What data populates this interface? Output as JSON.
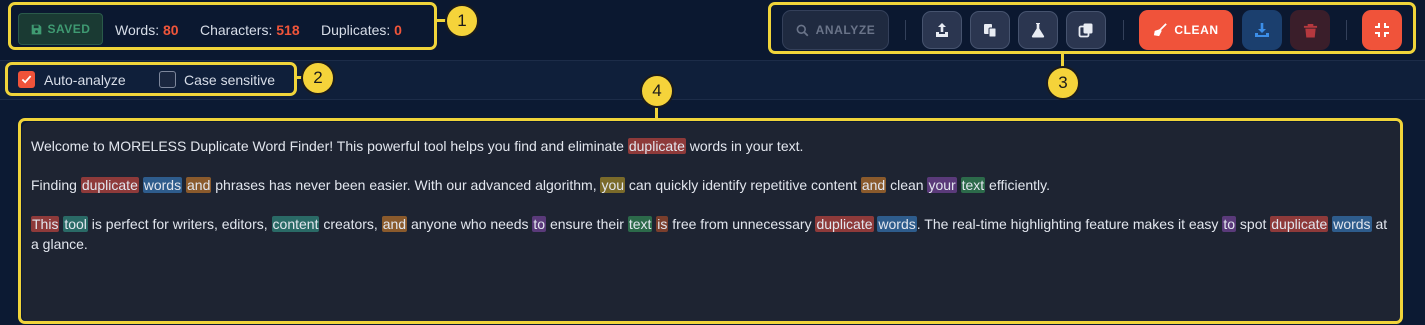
{
  "toolbar": {
    "saved_label": "SAVED",
    "words_label": "Words:",
    "words_value": "80",
    "chars_label": "Characters:",
    "chars_value": "518",
    "dups_label": "Duplicates:",
    "dups_value": "0",
    "analyze_label": "ANALYZE",
    "clean_label": "CLEAN",
    "icons": [
      "upload-icon",
      "paste-icon",
      "flask-icon",
      "copy-icon",
      "broom-icon",
      "download-icon",
      "trash-icon",
      "collapse-icon"
    ]
  },
  "options": {
    "auto_analyze": {
      "label": "Auto-analyze",
      "checked": true
    },
    "case_sensitive": {
      "label": "Case sensitive",
      "checked": false
    }
  },
  "callouts": [
    "1",
    "2",
    "3",
    "4"
  ],
  "editor": {
    "paragraphs": [
      [
        {
          "t": "Welcome to MORELESS Duplicate Word Finder! This powerful tool helps you find and eliminate "
        },
        {
          "t": "duplicate",
          "c": "red"
        },
        {
          "t": " words in your text."
        }
      ],
      [
        {
          "t": "Finding "
        },
        {
          "t": "duplicate",
          "c": "red"
        },
        {
          "t": " "
        },
        {
          "t": "words",
          "c": "blue"
        },
        {
          "t": " "
        },
        {
          "t": "and",
          "c": "orange"
        },
        {
          "t": " phrases has never been easier. With our advanced algorithm, "
        },
        {
          "t": "you",
          "c": "olive"
        },
        {
          "t": " can quickly identify repetitive content "
        },
        {
          "t": "and",
          "c": "orange"
        },
        {
          "t": " clean "
        },
        {
          "t": "your",
          "c": "purple"
        },
        {
          "t": " "
        },
        {
          "t": "text",
          "c": "green"
        },
        {
          "t": " efficiently."
        }
      ],
      [
        {
          "t": "This",
          "c": "red"
        },
        {
          "t": " "
        },
        {
          "t": "tool",
          "c": "teal"
        },
        {
          "t": " is perfect for writers, editors, "
        },
        {
          "t": "content",
          "c": "teal"
        },
        {
          "t": " creators, "
        },
        {
          "t": "and",
          "c": "orange"
        },
        {
          "t": " anyone who needs "
        },
        {
          "t": "to",
          "c": "purple"
        },
        {
          "t": " ensure their "
        },
        {
          "t": "text",
          "c": "green"
        },
        {
          "t": " "
        },
        {
          "t": "is",
          "c": "brown"
        },
        {
          "t": " free from unnecessary "
        },
        {
          "t": "duplicate",
          "c": "red"
        },
        {
          "t": " "
        },
        {
          "t": "words",
          "c": "blue"
        },
        {
          "t": ". The real-time highlighting feature makes it easy "
        },
        {
          "t": "to",
          "c": "purple"
        },
        {
          "t": " spot "
        },
        {
          "t": "duplicate",
          "c": "red"
        },
        {
          "t": " "
        },
        {
          "t": "words",
          "c": "blue"
        },
        {
          "t": " at a glance."
        }
      ]
    ]
  }
}
